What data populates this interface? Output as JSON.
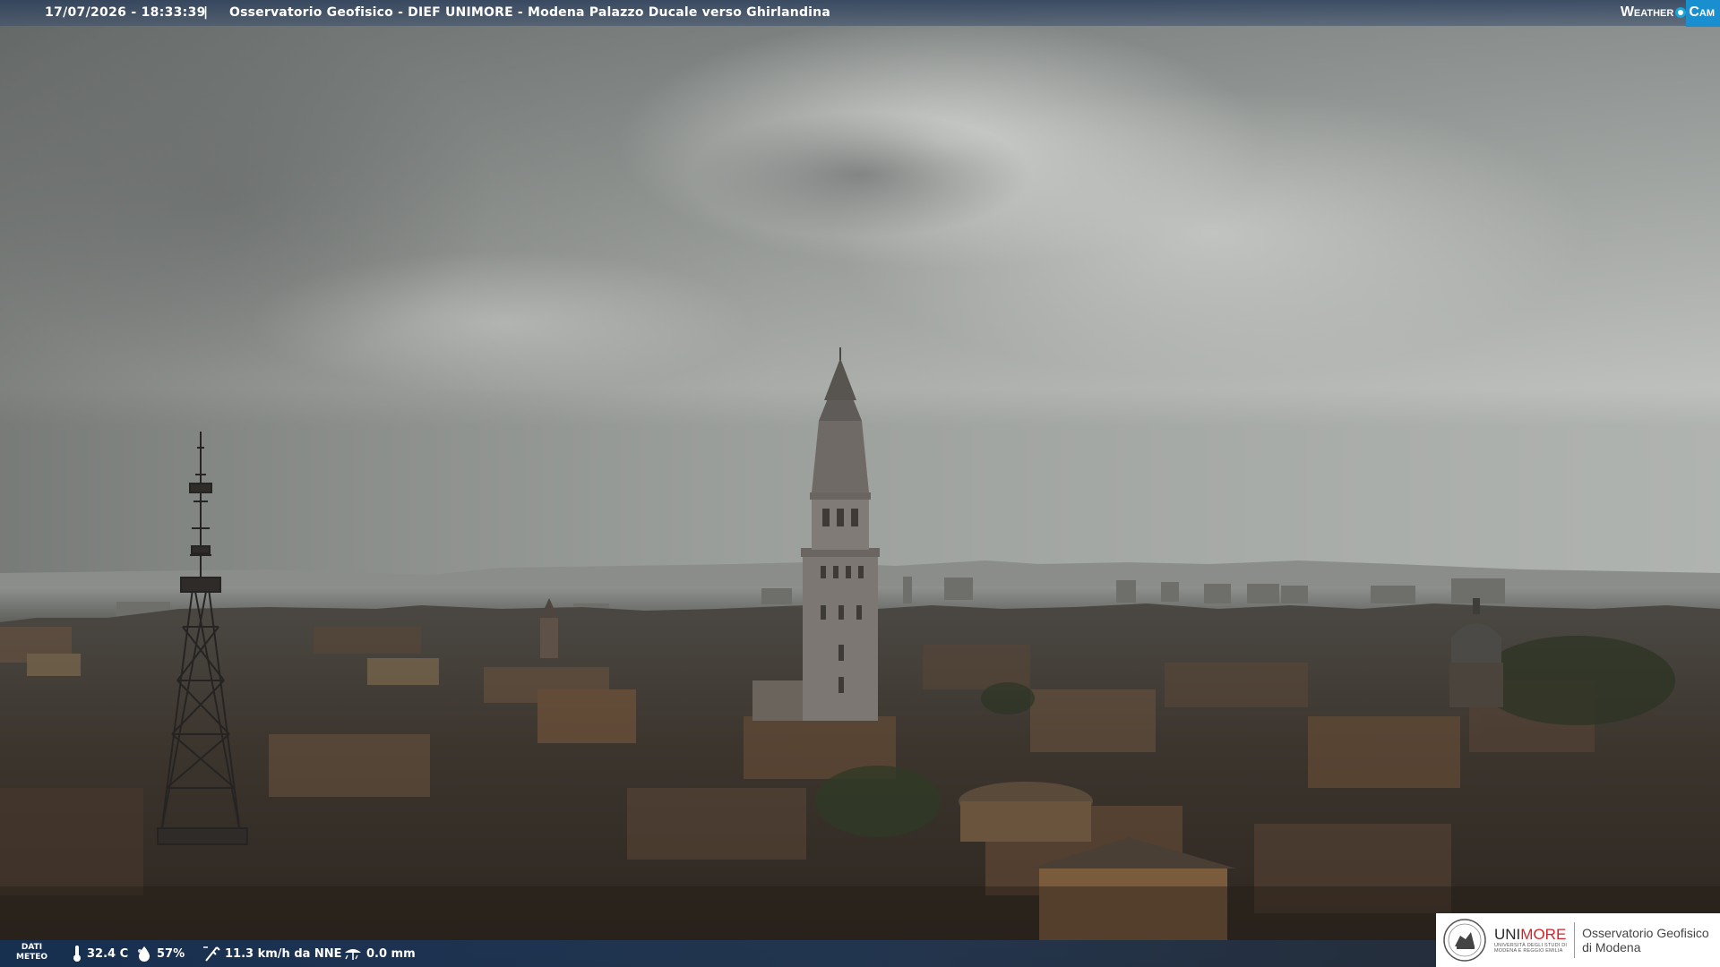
{
  "overlay": {
    "timestamp": "17/07/2026 - 18:33:39",
    "separator": "|",
    "title": "Osservatorio Geofisico - DIEF UNIMORE - Modena Palazzo Ducale verso Ghirlandina"
  },
  "brand": {
    "weather": "Weather",
    "cam": "Cam"
  },
  "weather": {
    "label_line1": "DATI",
    "label_line2": "METEO",
    "temperature": "32.4 C",
    "humidity": "57%",
    "wind": "11.3 km/h da NNE",
    "rain": "0.0 mm"
  },
  "logo": {
    "uni": "UNI",
    "more": "MORE",
    "subline1": "UNIVERSITÀ DEGLI STUDI DI",
    "subline2": "MODENA E REGGIO EMILIA",
    "observatory_line1": "Osservatorio Geofisico",
    "observatory_line2": "di Modena"
  },
  "colors": {
    "brand_red": "#d2232a",
    "cam_blue": "#1a8fd0"
  },
  "icons": {
    "temperature": "thermometer-icon",
    "humidity": "droplet-icon",
    "wind": "wind-icon",
    "rain": "rain-gauge-icon"
  }
}
